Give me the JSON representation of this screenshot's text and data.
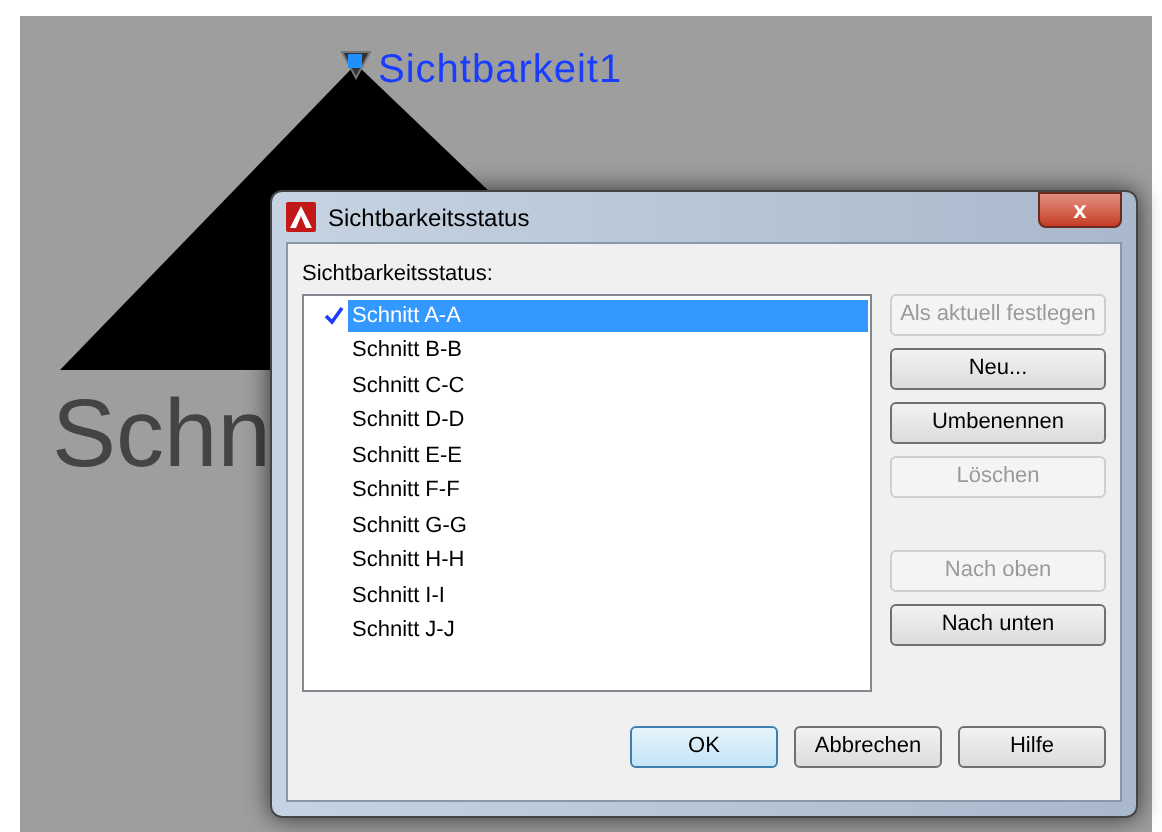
{
  "canvas": {
    "parameter_label": "Sichtbarkeit1",
    "drawing_text": "Schn"
  },
  "dialog": {
    "title": "Sichtbarkeitsstatus",
    "close": "x",
    "list_label": "Sichtbarkeitsstatus:",
    "states": [
      {
        "label": "Schnitt A-A",
        "selected": true,
        "checked": true
      },
      {
        "label": "Schnitt B-B",
        "selected": false,
        "checked": false
      },
      {
        "label": "Schnitt C-C",
        "selected": false,
        "checked": false
      },
      {
        "label": "Schnitt D-D",
        "selected": false,
        "checked": false
      },
      {
        "label": "Schnitt E-E",
        "selected": false,
        "checked": false
      },
      {
        "label": "Schnitt F-F",
        "selected": false,
        "checked": false
      },
      {
        "label": "Schnitt G-G",
        "selected": false,
        "checked": false
      },
      {
        "label": "Schnitt H-H",
        "selected": false,
        "checked": false
      },
      {
        "label": "Schnitt I-I",
        "selected": false,
        "checked": false
      },
      {
        "label": "Schnitt J-J",
        "selected": false,
        "checked": false
      }
    ],
    "side_buttons": [
      {
        "label": "Als aktuell festlegen",
        "disabled": true
      },
      {
        "label": "Neu...",
        "disabled": false
      },
      {
        "label": "Umbenennen",
        "disabled": false
      },
      {
        "label": "Löschen",
        "disabled": true
      }
    ],
    "move_buttons": [
      {
        "label": "Nach oben",
        "disabled": true
      },
      {
        "label": "Nach unten",
        "disabled": false
      }
    ],
    "footer_buttons": [
      {
        "label": "OK",
        "default": true
      },
      {
        "label": "Abbrechen",
        "default": false
      },
      {
        "label": "Hilfe",
        "default": false
      }
    ]
  }
}
